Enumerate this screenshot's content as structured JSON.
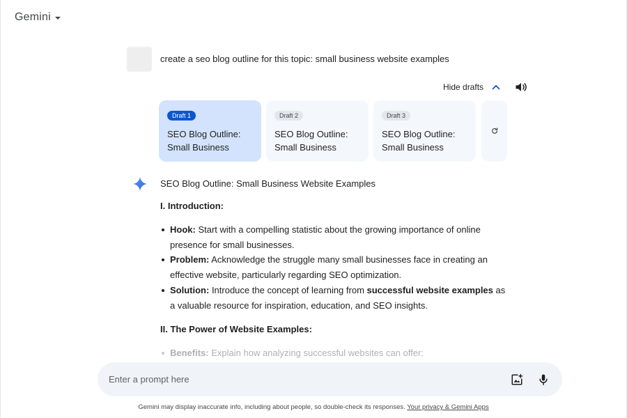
{
  "header": {
    "title": "Gemini"
  },
  "conversation": {
    "user_prompt": "create a seo blog outline for this topic: small business website examples"
  },
  "drafts": {
    "hide_label": "Hide drafts",
    "items": [
      {
        "badge": "Draft 1",
        "text": "SEO Blog Outline: Small Business",
        "active": true
      },
      {
        "badge": "Draft 2",
        "text": "SEO Blog Outline: Small Business",
        "active": false
      },
      {
        "badge": "Draft 3",
        "text": "SEO Blog Outline: Small Business",
        "active": false
      }
    ]
  },
  "response": {
    "title": "SEO Blog Outline: Small Business Website Examples",
    "section1": "I. Introduction:",
    "bullets": [
      {
        "label": "Hook:",
        "text": " Start with a compelling statistic about the growing importance of online presence for small businesses."
      },
      {
        "label": "Problem:",
        "text": " Acknowledge the struggle many small businesses face in creating an effective website, particularly regarding SEO optimization."
      },
      {
        "label": "Solution:",
        "text_before": " Introduce the concept of learning from ",
        "bold": "successful website examples",
        "text_after": " as a valuable resource for inspiration, education, and SEO insights."
      }
    ],
    "section2": "II. The Power of Website Examples:",
    "bullet_faded": {
      "label": "Benefits:",
      "text": " Explain how analyzing successful websites can offer:"
    }
  },
  "input": {
    "placeholder": "Enter a prompt here"
  },
  "footer": {
    "disclaimer": "Gemini may display inaccurate info, including about people, so double-check its responses. ",
    "link": "Your privacy & Gemini Apps"
  },
  "colors": {
    "accent": "#0b57d0",
    "active_card": "#d3e3fd",
    "card": "#f4f8fd",
    "input_bg": "#f0f4f9"
  },
  "icons": {
    "brand_menu": "chevron-down-icon",
    "hide_drafts": "chevron-up-icon",
    "speaker": "speaker-icon",
    "regenerate": "refresh-icon",
    "response": "gemini-spark-icon",
    "image_upload": "image-upload-icon",
    "microphone": "microphone-icon"
  }
}
